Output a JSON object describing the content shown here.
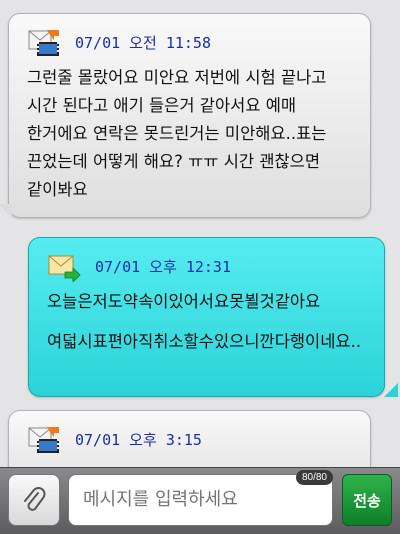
{
  "messages": [
    {
      "direction": "received",
      "icon": "mms-film-icon",
      "time": "07/01 오전 11:58",
      "text": "그런줄 몰랐어요 미안요 저번에 시험 끝나고 시간 된다고 애기 들은거 같아서요 예매 한거에요 연락은 못드린거는 미안해요..표는 끈었는데 어떻게 해요? ㅠㅠ 시간 괜찮으면 같이봐요"
    },
    {
      "direction": "sent",
      "icon": "envelope-send-icon",
      "time": "07/01 오후 12:31",
      "text1": "오늘은저도약속이있어서요못뵐것같아요",
      "text2": "여덟시표편아직취소할수있으니깐다행이네요.."
    },
    {
      "direction": "received",
      "icon": "mms-film-icon",
      "time": "07/01 오후 3:15"
    }
  ],
  "composer": {
    "placeholder": "메시지를 입력하세요",
    "counter": "80/80",
    "send_label": "전송",
    "attach_icon": "paperclip-icon"
  },
  "colors": {
    "received_bubble": "#e4e4e4",
    "sent_bubble": "#3ce0e5",
    "timestamp": "#1c2da6",
    "send_button": "#1a9a36"
  }
}
